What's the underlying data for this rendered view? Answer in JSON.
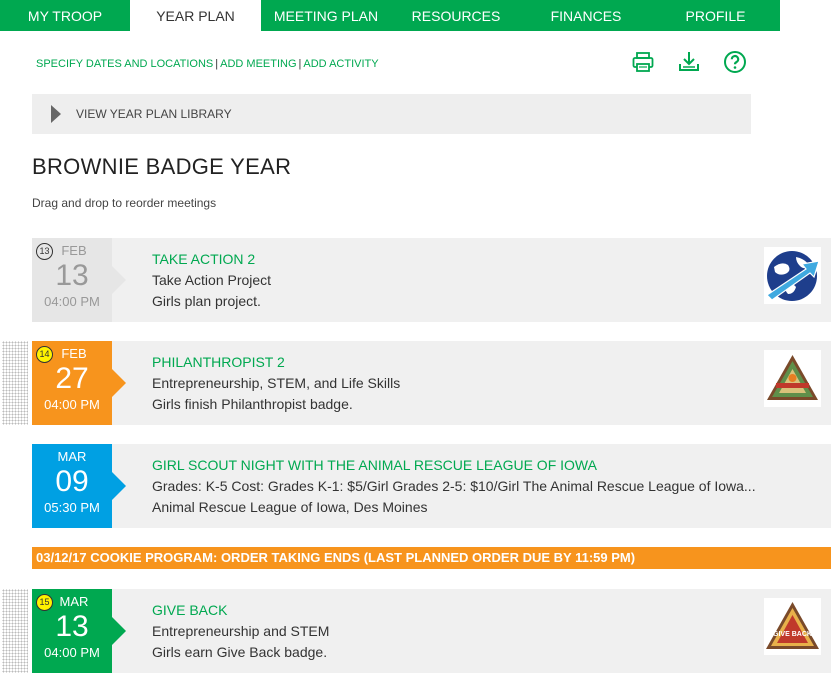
{
  "nav": {
    "tabs": [
      {
        "label": "MY TROOP"
      },
      {
        "label": "YEAR PLAN"
      },
      {
        "label": "MEETING PLAN"
      },
      {
        "label": "RESOURCES"
      },
      {
        "label": "FINANCES"
      },
      {
        "label": "PROFILE"
      }
    ],
    "active": "YEAR PLAN"
  },
  "actions": {
    "specify": "SPECIFY DATES AND LOCATIONS",
    "add_meeting": "ADD MEETING",
    "add_activity": "ADD ACTIVITY",
    "sep": "|"
  },
  "tools": [
    "printer-icon",
    "download-icon",
    "help-icon"
  ],
  "library": {
    "label": "VIEW YEAR PLAN LIBRARY"
  },
  "plan": {
    "title": "BROWNIE BADGE YEAR",
    "hint": "Drag and drop to reorder meetings"
  },
  "meetings": [
    {
      "number": "13",
      "month": "FEB",
      "day": "13",
      "time": "04:00 PM",
      "title": "TAKE ACTION 2",
      "line1": "Take Action Project",
      "line2": "Girls plan project.",
      "color": "#e6e6e6",
      "text_color": "#999999",
      "badge_icon": "globe-arrow-icon"
    },
    {
      "number": "14",
      "month": "FEB",
      "day": "27",
      "time": "04:00 PM",
      "title": "PHILANTHROPIST 2",
      "line1": "Entrepreneurship, STEM, and Life Skills",
      "line2": "Girls finish Philanthropist badge.",
      "color": "#f7941d",
      "text_color": "#ffffff",
      "badge_icon": "philanthropist-badge-icon"
    },
    {
      "number": "",
      "month": "MAR",
      "day": "09",
      "time": "05:30 PM",
      "title": "GIRL SCOUT NIGHT WITH THE ANIMAL RESCUE LEAGUE OF IOWA",
      "line1": "Grades: K-5 Cost: Grades K-1: $5/Girl Grades 2-5: $10/Girl The Animal Rescue League of Iowa...",
      "line2": "Animal Rescue League of Iowa, Des Moines",
      "color": "#00a0e3",
      "text_color": "#ffffff",
      "badge_icon": ""
    },
    {
      "number": "15",
      "month": "MAR",
      "day": "13",
      "time": "04:00 PM",
      "title": "GIVE BACK",
      "line1": "Entrepreneurship and STEM",
      "line2": "Girls earn Give Back badge.",
      "color": "#00a850",
      "text_color": "#ffffff",
      "badge_icon": "give-back-badge-icon",
      "badge_text": "GIVE BACK"
    }
  ],
  "cookie_banner": "03/12/17 COOKIE PROGRAM: ORDER TAKING ENDS (LAST PLANNED ORDER DUE BY 11:59 PM)",
  "colors": {
    "brand_green": "#00a850",
    "orange": "#f7941d",
    "blue": "#00a0e3"
  }
}
